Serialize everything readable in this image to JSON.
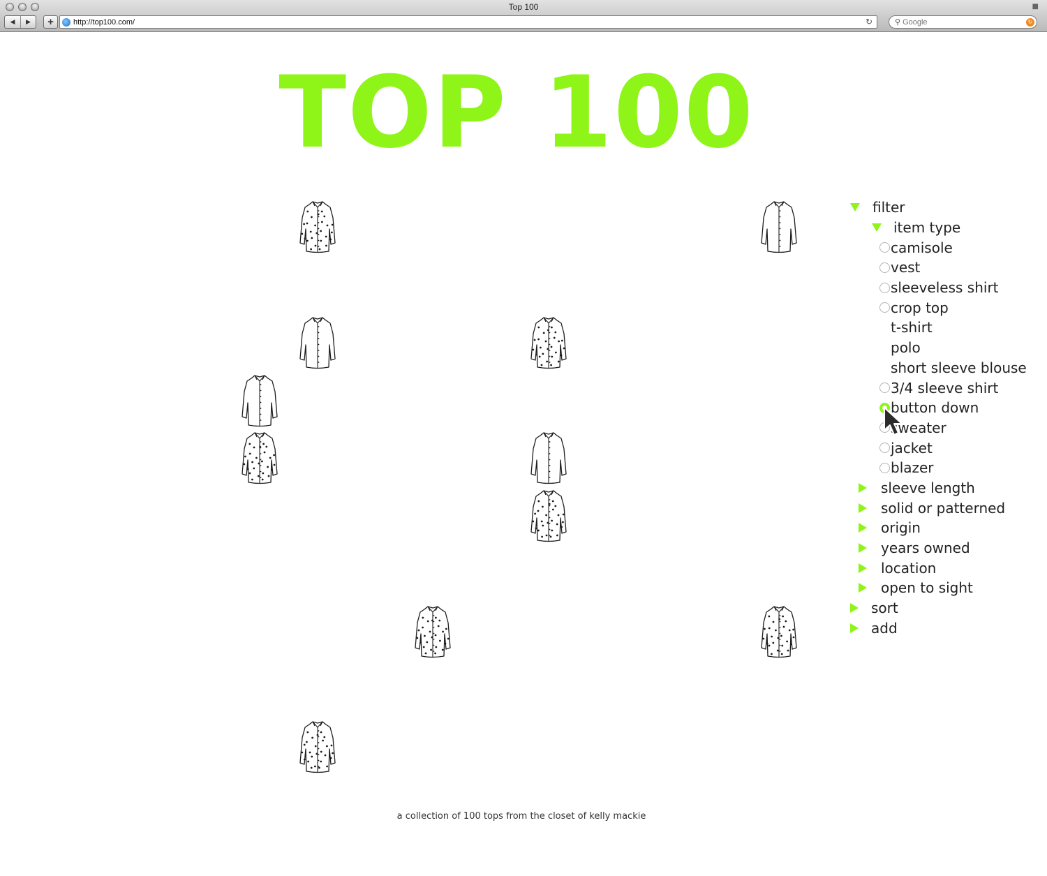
{
  "browser": {
    "window_title": "Top 100",
    "url": "http://top100.com/",
    "search_placeholder": "Google"
  },
  "colors": {
    "accent": "#8ff418",
    "text": "#222222"
  },
  "page": {
    "title": "TOP 100",
    "footer": "a collection of 100 tops from the closet of kelly mackie"
  },
  "shirts": [
    {
      "pattern": "dotted"
    },
    {
      "pattern": "plain"
    },
    {
      "pattern": "plain"
    },
    {
      "pattern": "dotted"
    },
    {
      "pattern": "plain"
    },
    {
      "pattern": "dotted"
    },
    {
      "pattern": "plain"
    },
    {
      "pattern": "dotted"
    },
    {
      "pattern": "dotted"
    },
    {
      "pattern": "dotted"
    },
    {
      "pattern": "dotted"
    }
  ],
  "filter_panel": {
    "filter_label": "filter",
    "item_type": {
      "label": "item type",
      "options": [
        {
          "label": "camisole",
          "radio": "unselected"
        },
        {
          "label": "vest",
          "radio": "unselected"
        },
        {
          "label": "sleeveless shirt",
          "radio": "unselected"
        },
        {
          "label": "crop top",
          "radio": "unselected"
        },
        {
          "label": "t-shirt",
          "radio": "none"
        },
        {
          "label": "polo",
          "radio": "none"
        },
        {
          "label": "short sleeve blouse",
          "radio": "none"
        },
        {
          "label": "3/4 sleeve shirt",
          "radio": "unselected"
        },
        {
          "label": "button down",
          "radio": "selected"
        },
        {
          "label": "sweater",
          "radio": "unselected"
        },
        {
          "label": "jacket",
          "radio": "unselected"
        },
        {
          "label": "blazer",
          "radio": "unselected"
        }
      ]
    },
    "sub_filters": [
      "sleeve length",
      "solid or patterned",
      "origin",
      "years owned",
      "location",
      "open to sight"
    ],
    "sort_label": "sort",
    "add_label": "add"
  }
}
